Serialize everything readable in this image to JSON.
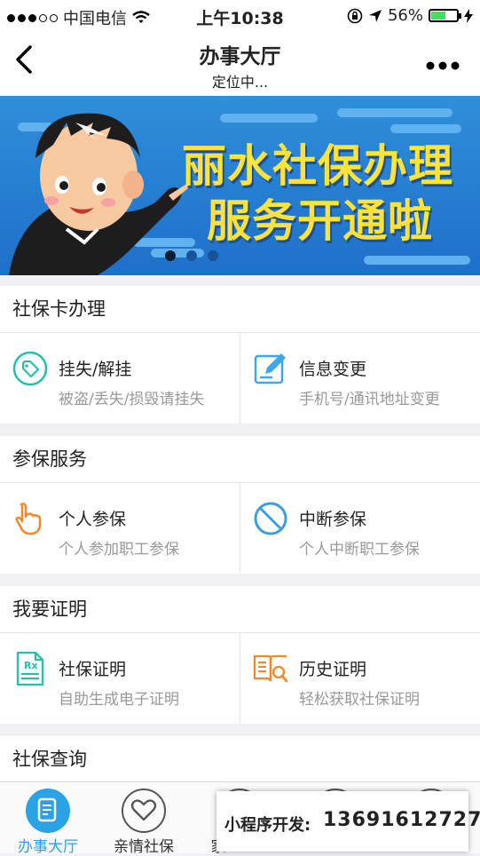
{
  "status_bar": {
    "carrier": "中国电信",
    "time": "上午10:38",
    "battery": "56%",
    "battery_level": 0.56
  },
  "nav": {
    "title": "办事大厅",
    "subtitle": "定位中..."
  },
  "banner": {
    "line1": "丽水社保办理",
    "line2": "服务开通啦",
    "slides": 3,
    "active_slide": 0
  },
  "sections": [
    {
      "title": "社保卡办理",
      "items": [
        {
          "name": "挂失/解挂",
          "desc": "被盗/丢失/损毁请挂失",
          "icon": "tag-icon"
        },
        {
          "name": "信息变更",
          "desc": "手机号/通讯地址变更",
          "icon": "edit-icon"
        }
      ]
    },
    {
      "title": "参保服务",
      "items": [
        {
          "name": "个人参保",
          "desc": "个人参加职工参保",
          "icon": "hand-pointer-icon"
        },
        {
          "name": "中断参保",
          "desc": "个人中断职工参保",
          "icon": "ban-icon"
        }
      ]
    },
    {
      "title": "我要证明",
      "items": [
        {
          "name": "社保证明",
          "desc": "自助生成电子证明",
          "icon": "prescription-doc-icon"
        },
        {
          "name": "历史证明",
          "desc": "轻松获取社保证明",
          "icon": "book-search-icon"
        }
      ]
    },
    {
      "title": "社保查询"
    }
  ],
  "tabbar": [
    {
      "label": "办事大厅",
      "active": true
    },
    {
      "label": "亲情社保",
      "active": false
    },
    {
      "label": "家",
      "active": false
    }
  ],
  "promo": {
    "label": "小程序开发:",
    "phone": "13691612727"
  },
  "colors": {
    "accent": "#29a3e6",
    "banner_text": "#ffe33a",
    "tag_icon": "#22c1a8",
    "edit_icon": "#3da7e8",
    "hand_icon": "#f2872c",
    "ban_icon": "#3e9fd6",
    "doc_icon": "#22c1a8",
    "book_icon": "#f2872c"
  }
}
